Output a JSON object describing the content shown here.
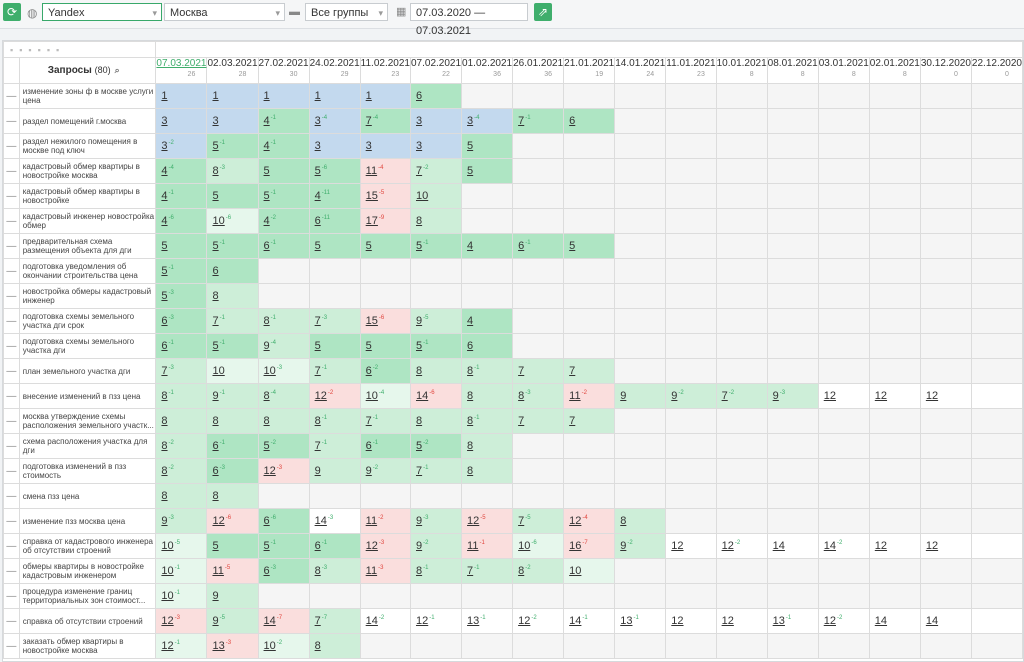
{
  "toolbar": {
    "refresh_icon": "refresh-icon",
    "search_engine": "Yandex",
    "region": "Москва",
    "group": "Все группы",
    "date_range": "07.03.2020 — 07.03.2021",
    "export_icon": "export-icon"
  },
  "table": {
    "header_label": "Запросы",
    "header_count": "(80)",
    "dates": [
      {
        "date": "07.03.2021",
        "count": "26"
      },
      {
        "date": "02.03.2021",
        "count": "28"
      },
      {
        "date": "27.02.2021",
        "count": "30"
      },
      {
        "date": "24.02.2021",
        "count": "29"
      },
      {
        "date": "11.02.2021",
        "count": "23"
      },
      {
        "date": "07.02.2021",
        "count": "22"
      },
      {
        "date": "01.02.2021",
        "count": "36"
      },
      {
        "date": "26.01.2021",
        "count": "36"
      },
      {
        "date": "21.01.2021",
        "count": "19"
      },
      {
        "date": "14.01.2021",
        "count": "24"
      },
      {
        "date": "11.01.2021",
        "count": "23"
      },
      {
        "date": "10.01.2021",
        "count": "8"
      },
      {
        "date": "08.01.2021",
        "count": "8"
      },
      {
        "date": "03.01.2021",
        "count": "8"
      },
      {
        "date": "02.01.2021",
        "count": "8"
      },
      {
        "date": "30.12.2020",
        "count": "0"
      },
      {
        "date": "22.12.2020",
        "count": "0"
      }
    ],
    "rows": [
      {
        "q": "изменение зоны ф в москве услуги цена",
        "cells": [
          {
            "v": "1",
            "bg": "b"
          },
          {
            "v": "1",
            "bg": "b"
          },
          {
            "v": "1",
            "bg": "b"
          },
          {
            "v": "1",
            "bg": "b"
          },
          {
            "v": "1",
            "bg": "b"
          },
          {
            "v": "6",
            "bg": "g"
          }
        ]
      },
      {
        "q": "раздел помещений г.москва",
        "cells": [
          {
            "v": "3",
            "bg": "b"
          },
          {
            "v": "3",
            "bg": "b"
          },
          {
            "v": "4",
            "d": "-1",
            "bg": "g"
          },
          {
            "v": "3",
            "d": "-4",
            "bg": "b"
          },
          {
            "v": "7",
            "d": "-4",
            "bg": "g"
          },
          {
            "v": "3",
            "bg": "b"
          },
          {
            "v": "3",
            "d": "-4",
            "bg": "b"
          },
          {
            "v": "7",
            "d": "-1",
            "bg": "g"
          },
          {
            "v": "6",
            "bg": "g"
          }
        ]
      },
      {
        "q": "раздел нежилого помещения в москве под ключ",
        "cells": [
          {
            "v": "3",
            "d": "-2",
            "bg": "b"
          },
          {
            "v": "5",
            "d": "-1",
            "bg": "g"
          },
          {
            "v": "4",
            "d": "-1",
            "bg": "g"
          },
          {
            "v": "3",
            "bg": "b"
          },
          {
            "v": "3",
            "bg": "b"
          },
          {
            "v": "3",
            "bg": "b"
          },
          {
            "v": "5",
            "bg": "g"
          }
        ]
      },
      {
        "q": "кадастровый обмер квартиры в новостройке москва",
        "cells": [
          {
            "v": "4",
            "d": "-4",
            "bg": "g"
          },
          {
            "v": "8",
            "d": "-3",
            "bg": "lg"
          },
          {
            "v": "5",
            "bg": "g"
          },
          {
            "v": "5",
            "d": "-6",
            "bg": "g"
          },
          {
            "v": "11",
            "d": "-4",
            "bg": "p"
          },
          {
            "v": "7",
            "d": "-2",
            "bg": "lg"
          },
          {
            "v": "5",
            "bg": "g"
          }
        ]
      },
      {
        "q": "кадастровый обмер квартиры в новостройке",
        "cells": [
          {
            "v": "4",
            "d": "-1",
            "bg": "g"
          },
          {
            "v": "5",
            "bg": "g"
          },
          {
            "v": "5",
            "d": "-1",
            "bg": "g"
          },
          {
            "v": "4",
            "d": "-11",
            "bg": "g"
          },
          {
            "v": "15",
            "d": "-5",
            "bg": "p"
          },
          {
            "v": "10",
            "bg": "lg"
          }
        ]
      },
      {
        "q": "кадастровый инженер новостройка обмер",
        "cells": [
          {
            "v": "4",
            "d": "-6",
            "bg": "g"
          },
          {
            "v": "10",
            "d": "-6",
            "bg": "vlg"
          },
          {
            "v": "4",
            "d": "-2",
            "bg": "g"
          },
          {
            "v": "6",
            "d": "-11",
            "bg": "g"
          },
          {
            "v": "17",
            "d": "-9",
            "bg": "p"
          },
          {
            "v": "8",
            "bg": "lg"
          }
        ]
      },
      {
        "q": "предварительная схема размещения объекта для дги",
        "cells": [
          {
            "v": "5",
            "bg": "g"
          },
          {
            "v": "5",
            "d": "-1",
            "bg": "g"
          },
          {
            "v": "6",
            "d": "-1",
            "bg": "g"
          },
          {
            "v": "5",
            "bg": "g"
          },
          {
            "v": "5",
            "bg": "g"
          },
          {
            "v": "5",
            "d": "-1",
            "bg": "g"
          },
          {
            "v": "4",
            "bg": "g"
          },
          {
            "v": "6",
            "d": "-1",
            "bg": "g"
          },
          {
            "v": "5",
            "bg": "g"
          }
        ]
      },
      {
        "q": "подготовка уведомления об окончании строительства цена",
        "cells": [
          {
            "v": "5",
            "d": "-1",
            "bg": "g"
          },
          {
            "v": "6",
            "bg": "g"
          }
        ]
      },
      {
        "q": "новостройка обмеры кадастровый инженер",
        "cells": [
          {
            "v": "5",
            "d": "-3",
            "bg": "g"
          },
          {
            "v": "8",
            "bg": "lg"
          }
        ]
      },
      {
        "q": "подготовка схемы земельного участка дги срок",
        "cells": [
          {
            "v": "6",
            "d": "-3",
            "bg": "g"
          },
          {
            "v": "7",
            "d": "-1",
            "bg": "lg"
          },
          {
            "v": "8",
            "d": "-1",
            "bg": "lg"
          },
          {
            "v": "7",
            "d": "-3",
            "bg": "lg"
          },
          {
            "v": "15",
            "d": "-6",
            "bg": "p"
          },
          {
            "v": "9",
            "d": "-5",
            "bg": "lg"
          },
          {
            "v": "4",
            "bg": "g"
          }
        ]
      },
      {
        "q": "подготовка схемы земельного участка дги",
        "cells": [
          {
            "v": "6",
            "d": "-1",
            "bg": "g"
          },
          {
            "v": "5",
            "d": "-1",
            "bg": "g"
          },
          {
            "v": "9",
            "d": "-4",
            "bg": "lg"
          },
          {
            "v": "5",
            "bg": "g"
          },
          {
            "v": "5",
            "bg": "g"
          },
          {
            "v": "5",
            "d": "-1",
            "bg": "g"
          },
          {
            "v": "6",
            "bg": "g"
          }
        ]
      },
      {
        "q": "план земельного участка дги",
        "cells": [
          {
            "v": "7",
            "d": "-3",
            "bg": "lg"
          },
          {
            "v": "10",
            "bg": "vlg"
          },
          {
            "v": "10",
            "d": "-3",
            "bg": "vlg"
          },
          {
            "v": "7",
            "d": "-1",
            "bg": "lg"
          },
          {
            "v": "6",
            "d": "-2",
            "bg": "g"
          },
          {
            "v": "8",
            "bg": "lg"
          },
          {
            "v": "8",
            "d": "-1",
            "bg": "lg"
          },
          {
            "v": "7",
            "bg": "lg"
          },
          {
            "v": "7",
            "bg": "lg"
          }
        ]
      },
      {
        "q": "внесение изменений в пзз цена",
        "cells": [
          {
            "v": "8",
            "d": "-1",
            "bg": "lg"
          },
          {
            "v": "9",
            "d": "-1",
            "bg": "lg"
          },
          {
            "v": "8",
            "d": "-4",
            "bg": "lg"
          },
          {
            "v": "12",
            "d": "-2",
            "bg": "p"
          },
          {
            "v": "10",
            "d": "-4",
            "bg": "vlg"
          },
          {
            "v": "14",
            "d": "-6",
            "bg": "p"
          },
          {
            "v": "8",
            "bg": "lg"
          },
          {
            "v": "8",
            "d": "-3",
            "bg": "lg"
          },
          {
            "v": "11",
            "d": "-2",
            "bg": "p"
          },
          {
            "v": "9",
            "bg": "lg"
          },
          {
            "v": "9",
            "d": "-2",
            "bg": "lg"
          },
          {
            "v": "7",
            "d": "-2",
            "bg": "lg"
          },
          {
            "v": "9",
            "d": "-3",
            "bg": "lg"
          },
          {
            "v": "12",
            "bg": "w"
          },
          {
            "v": "12",
            "bg": "w"
          },
          {
            "v": "12",
            "bg": "w"
          },
          {
            "v": "",
            "bg": "w"
          }
        ]
      },
      {
        "q": "москва утверждение схемы расположения земельного участк...",
        "cells": [
          {
            "v": "8",
            "bg": "lg"
          },
          {
            "v": "8",
            "bg": "lg"
          },
          {
            "v": "8",
            "bg": "lg"
          },
          {
            "v": "8",
            "d": "-1",
            "bg": "lg"
          },
          {
            "v": "7",
            "d": "-1",
            "bg": "lg"
          },
          {
            "v": "8",
            "bg": "lg"
          },
          {
            "v": "8",
            "d": "-1",
            "bg": "lg"
          },
          {
            "v": "7",
            "bg": "lg"
          },
          {
            "v": "7",
            "bg": "lg"
          }
        ]
      },
      {
        "q": "схема расположения участка для дги",
        "cells": [
          {
            "v": "8",
            "d": "-2",
            "bg": "lg"
          },
          {
            "v": "6",
            "d": "-1",
            "bg": "g"
          },
          {
            "v": "5",
            "d": "-2",
            "bg": "g"
          },
          {
            "v": "7",
            "d": "-1",
            "bg": "lg"
          },
          {
            "v": "6",
            "d": "-1",
            "bg": "g"
          },
          {
            "v": "5",
            "d": "-2",
            "bg": "g"
          },
          {
            "v": "8",
            "bg": "lg"
          }
        ]
      },
      {
        "q": "подготовка изменений в пзз стоимость",
        "cells": [
          {
            "v": "8",
            "d": "-2",
            "bg": "lg"
          },
          {
            "v": "6",
            "d": "-3",
            "bg": "g"
          },
          {
            "v": "12",
            "d": "-3",
            "bg": "p"
          },
          {
            "v": "9",
            "bg": "lg"
          },
          {
            "v": "9",
            "d": "-2",
            "bg": "lg"
          },
          {
            "v": "7",
            "d": "-1",
            "bg": "lg"
          },
          {
            "v": "8",
            "bg": "lg"
          }
        ]
      },
      {
        "q": "смена пзз цена",
        "cells": [
          {
            "v": "8",
            "bg": "lg"
          },
          {
            "v": "8",
            "bg": "lg"
          }
        ]
      },
      {
        "q": "изменение пзз москва цена",
        "cells": [
          {
            "v": "9",
            "d": "-3",
            "bg": "lg"
          },
          {
            "v": "12",
            "d": "-6",
            "bg": "p"
          },
          {
            "v": "6",
            "d": "-6",
            "bg": "g"
          },
          {
            "v": "14",
            "d": "-3",
            "bg": "w"
          },
          {
            "v": "11",
            "d": "-2",
            "bg": "p"
          },
          {
            "v": "9",
            "d": "-3",
            "bg": "lg"
          },
          {
            "v": "12",
            "d": "-5",
            "bg": "p"
          },
          {
            "v": "7",
            "d": "-5",
            "bg": "lg"
          },
          {
            "v": "12",
            "d": "-4",
            "bg": "p"
          },
          {
            "v": "8",
            "bg": "lg"
          }
        ]
      },
      {
        "q": "справка от кадастрового инженера об отсутствии строений",
        "cells": [
          {
            "v": "10",
            "d": "-5",
            "bg": "vlg"
          },
          {
            "v": "5",
            "bg": "g"
          },
          {
            "v": "5",
            "d": "-1",
            "bg": "g"
          },
          {
            "v": "6",
            "d": "-1",
            "bg": "g"
          },
          {
            "v": "12",
            "d": "-3",
            "bg": "p"
          },
          {
            "v": "9",
            "d": "-2",
            "bg": "lg"
          },
          {
            "v": "11",
            "d": "-1",
            "bg": "p"
          },
          {
            "v": "10",
            "d": "-6",
            "bg": "vlg"
          },
          {
            "v": "16",
            "d": "-7",
            "bg": "p"
          },
          {
            "v": "9",
            "d": "-2",
            "bg": "lg"
          },
          {
            "v": "12",
            "bg": "w"
          },
          {
            "v": "12",
            "d": "-2",
            "bg": "w"
          },
          {
            "v": "14",
            "bg": "w"
          },
          {
            "v": "14",
            "d": "-2",
            "bg": "w"
          },
          {
            "v": "12",
            "bg": "w"
          },
          {
            "v": "12",
            "bg": "w"
          },
          {
            "v": "",
            "bg": "w"
          }
        ]
      },
      {
        "q": "обмеры квартиры в новостройке кадастровым инженером",
        "cells": [
          {
            "v": "10",
            "d": "-1",
            "bg": "vlg"
          },
          {
            "v": "11",
            "d": "-5",
            "bg": "p"
          },
          {
            "v": "6",
            "d": "-3",
            "bg": "g"
          },
          {
            "v": "8",
            "d": "-3",
            "bg": "lg"
          },
          {
            "v": "11",
            "d": "-3",
            "bg": "p"
          },
          {
            "v": "8",
            "d": "-1",
            "bg": "lg"
          },
          {
            "v": "7",
            "d": "-1",
            "bg": "lg"
          },
          {
            "v": "8",
            "d": "-2",
            "bg": "lg"
          },
          {
            "v": "10",
            "bg": "vlg"
          }
        ]
      },
      {
        "q": "процедура изменение границ территориальных зон стоимост...",
        "cells": [
          {
            "v": "10",
            "d": "-1",
            "bg": "vlg"
          },
          {
            "v": "9",
            "bg": "lg"
          }
        ]
      },
      {
        "q": "справка об отсутствии строений",
        "cells": [
          {
            "v": "12",
            "d": "-3",
            "bg": "p"
          },
          {
            "v": "9",
            "d": "-5",
            "bg": "lg"
          },
          {
            "v": "14",
            "d": "-7",
            "bg": "p"
          },
          {
            "v": "7",
            "d": "-7",
            "bg": "lg"
          },
          {
            "v": "14",
            "d": "-2",
            "bg": "w"
          },
          {
            "v": "12",
            "d": "-1",
            "bg": "w"
          },
          {
            "v": "13",
            "d": "-1",
            "bg": "w"
          },
          {
            "v": "12",
            "d": "-2",
            "bg": "w"
          },
          {
            "v": "14",
            "d": "-1",
            "bg": "w"
          },
          {
            "v": "13",
            "d": "-1",
            "bg": "w"
          },
          {
            "v": "12",
            "bg": "w"
          },
          {
            "v": "12",
            "bg": "w"
          },
          {
            "v": "13",
            "d": "-1",
            "bg": "w"
          },
          {
            "v": "12",
            "d": "-2",
            "bg": "w"
          },
          {
            "v": "14",
            "bg": "w"
          },
          {
            "v": "14",
            "bg": "w"
          },
          {
            "v": "",
            "bg": "w"
          }
        ]
      },
      {
        "q": "заказать обмер квартиры в новостройке москва",
        "cells": [
          {
            "v": "12",
            "d": "-1",
            "bg": "vlg"
          },
          {
            "v": "13",
            "d": "-3",
            "bg": "p"
          },
          {
            "v": "10",
            "d": "-2",
            "bg": "vlg"
          },
          {
            "v": "8",
            "bg": "lg"
          }
        ]
      }
    ]
  }
}
